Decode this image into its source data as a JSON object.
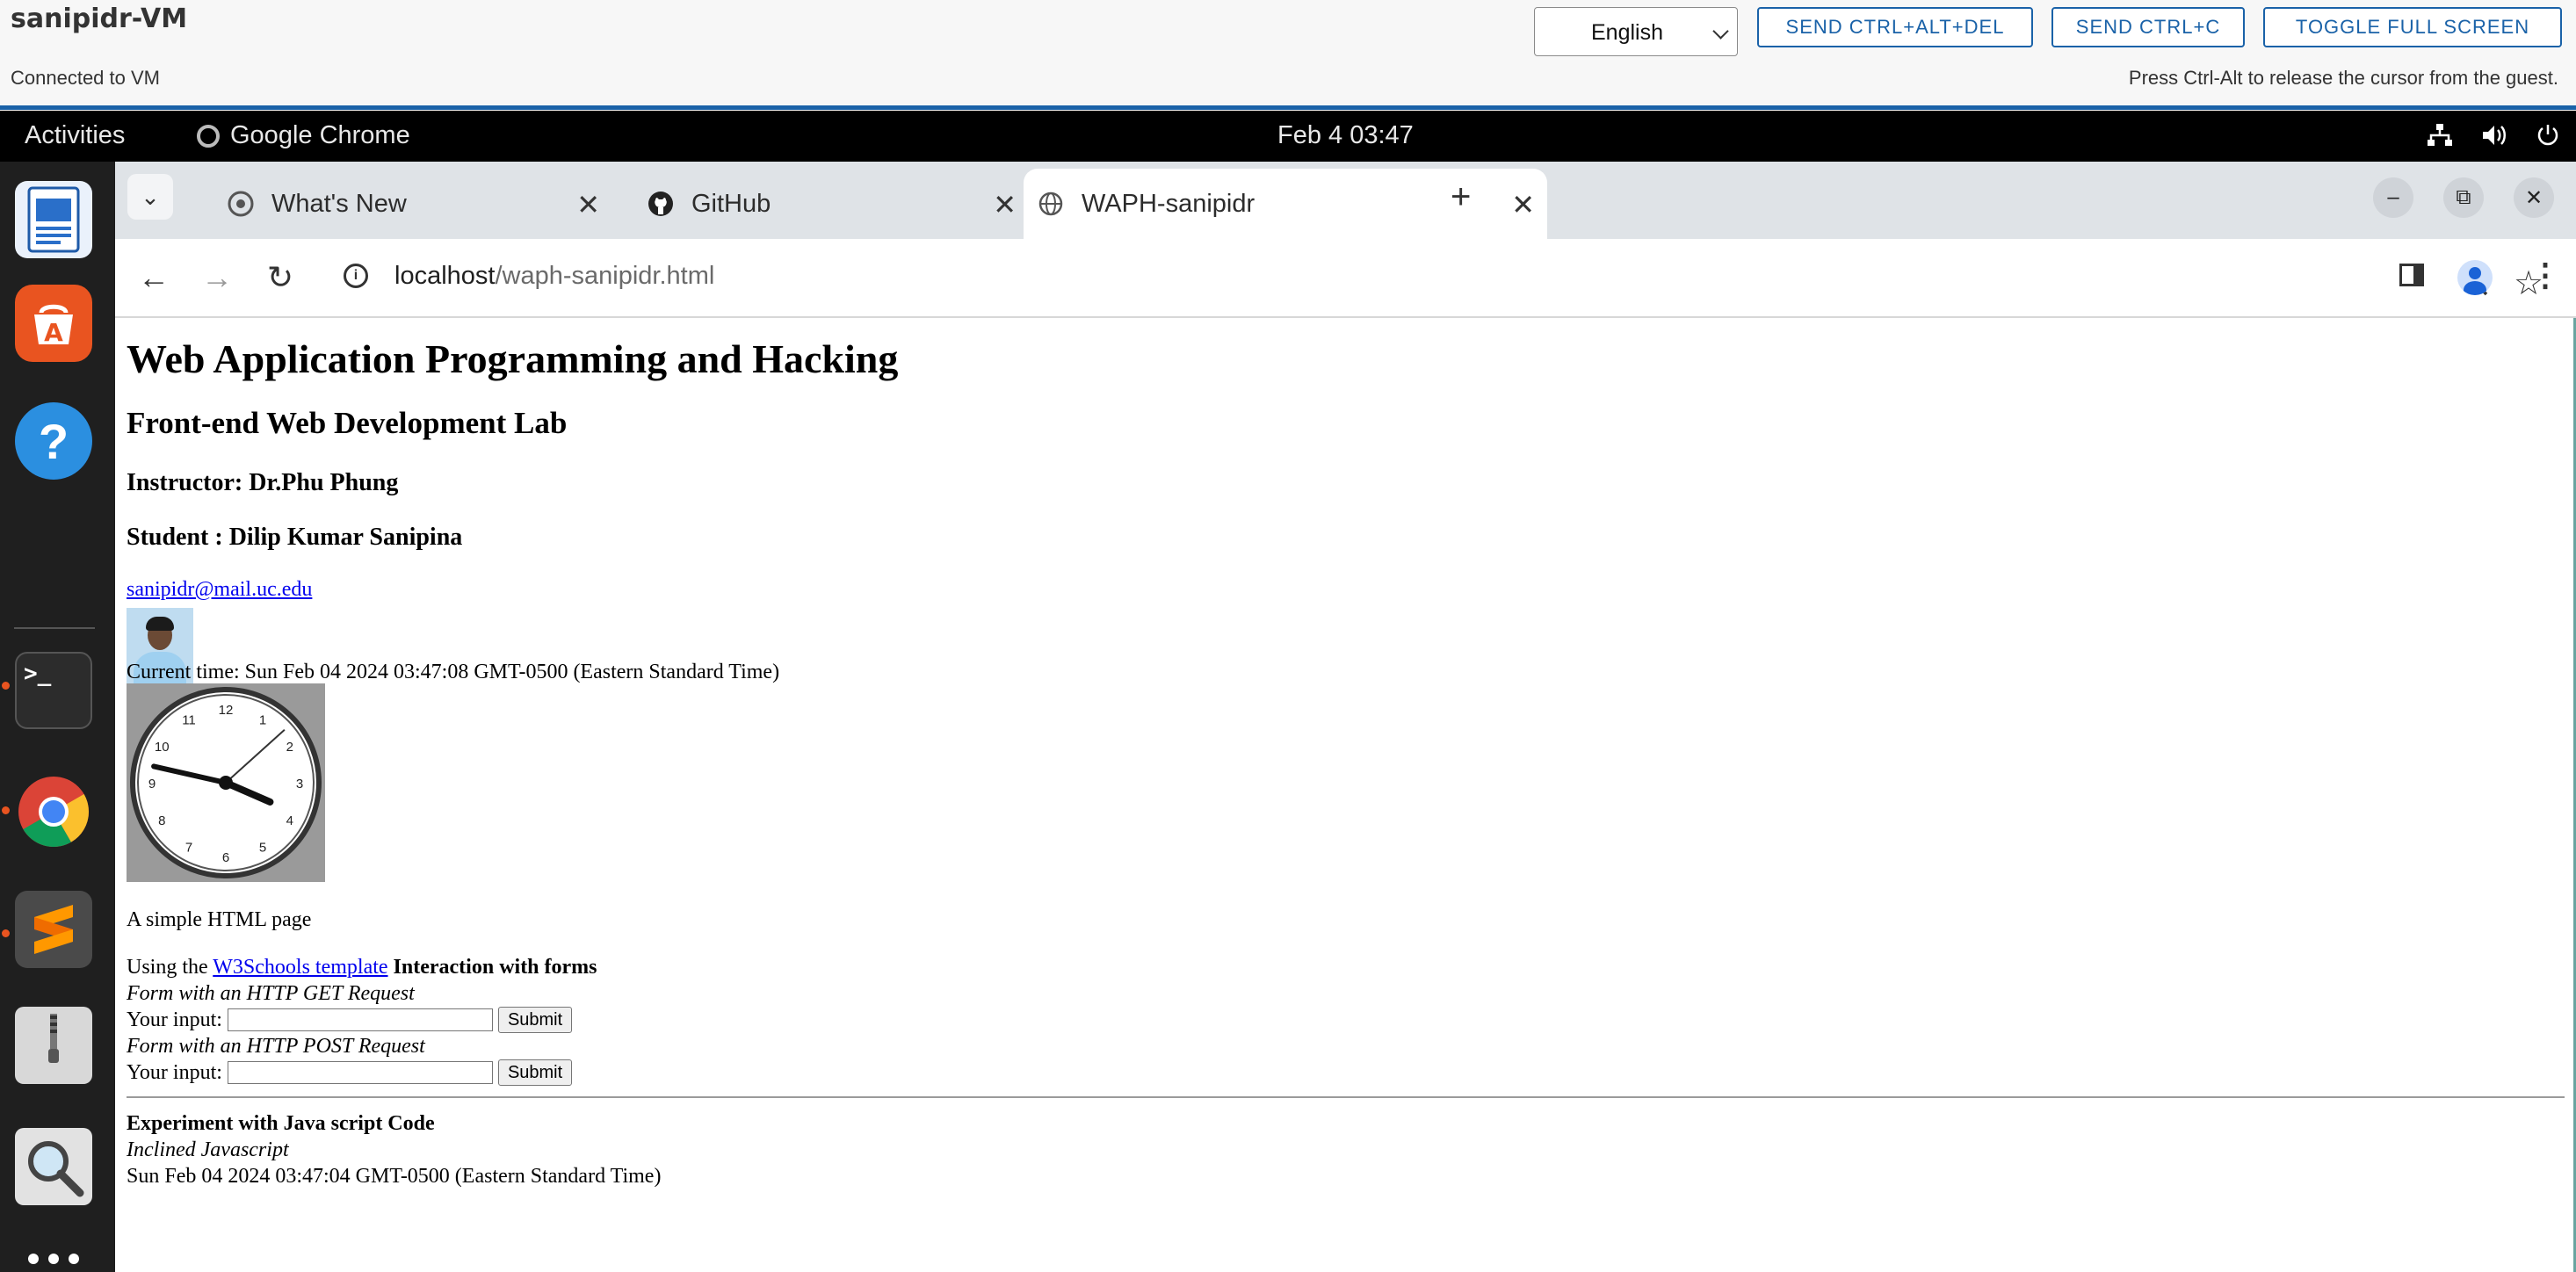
{
  "vm": {
    "title": "sanipidr-VM",
    "status": "Connected to VM",
    "language": "English",
    "buttons": {
      "ctrl_alt_del": "SEND CTRL+ALT+DEL",
      "ctrl_c": "SEND CTRL+C",
      "fullscreen": "TOGGLE FULL SCREEN"
    },
    "hint": "Press Ctrl-Alt to release the cursor from the guest.",
    "accent_color": "#1a62a8"
  },
  "topbar": {
    "activities": "Activities",
    "app_name": "Google Chrome",
    "datetime": "Feb 4  03:47",
    "tray_icons": [
      "network-icon",
      "volume-icon",
      "power-icon"
    ]
  },
  "dock": {
    "items": [
      "libreoffice-writer-icon",
      "app-center-icon",
      "help-icon",
      "terminal-icon",
      "chrome-icon",
      "sublime-text-icon",
      "archive-manager-icon",
      "image-viewer-icon",
      "show-apps-icon"
    ]
  },
  "browser": {
    "tabs": [
      {
        "title": "What's New",
        "icon": "chrome-icon",
        "active": false
      },
      {
        "title": "GitHub",
        "icon": "github-icon",
        "active": false
      },
      {
        "title": "WAPH-sanipidr",
        "icon": "globe-icon",
        "active": true
      }
    ],
    "url_host": "localhost",
    "url_path": "/waph-sanipidr.html"
  },
  "page": {
    "h1": "Web Application Programming and Hacking",
    "h2": "Front-end Web Development Lab",
    "instructor": "Instructor: Dr.Phu Phung",
    "student": "Student : Dilip Kumar Sanipina",
    "email": "sanipidr@mail.uc.edu",
    "current_time": "Current time: Sun Feb 04 2024 03:47:08 GMT-0500 (Eastern Standard Time)",
    "clock": {
      "numbers": [
        "12",
        "1",
        "2",
        "3",
        "4",
        "5",
        "6",
        "7",
        "8",
        "9",
        "10",
        "11"
      ],
      "hour": 3,
      "minute": 47,
      "second": 8
    },
    "simple_text": "A simple HTML page",
    "using_prefix": "Using the",
    "w3_link": "W3Schools template",
    "interaction": "Interaction with forms",
    "form_get_title": "Form with an HTTP GET Request",
    "form_post_title": "Form with an HTTP POST Request",
    "input_label": "Your input:",
    "submit_label": "Submit",
    "experiment": "Experiment with Java script Code",
    "inclined": "Inclined Javascript",
    "date_output": "Sun Feb 04 2024 03:47:04 GMT-0500 (Eastern Standard Time)"
  }
}
